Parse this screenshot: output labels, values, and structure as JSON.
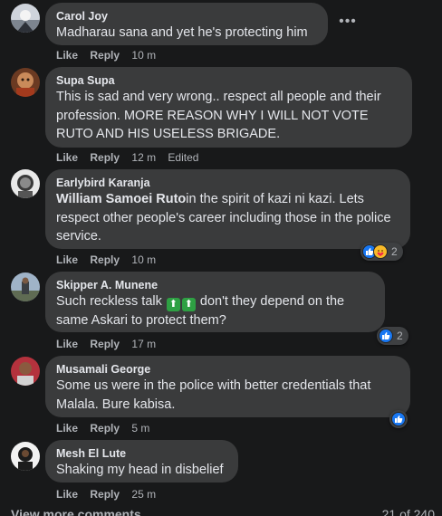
{
  "comments": [
    {
      "author": "Carol Joy",
      "text": "Madharau sana and yet he's protecting him",
      "like": "Like",
      "reply": "Reply",
      "time": "10 m"
    },
    {
      "author": "Supa Supa",
      "text": "This is sad and very wrong.. respect all people and their profession. MORE REASON WHY I WILL NOT VOTE RUTO AND HIS USELESS BRIGADE.",
      "like": "Like",
      "reply": "Reply",
      "time": "12 m",
      "edited": "Edited"
    },
    {
      "author": "Earlybird Karanja",
      "mention": "William Samoei Ruto",
      "text": "in the spirit of kazi ni kazi. Lets respect other people's career including those in the police service.",
      "like": "Like",
      "reply": "Reply",
      "time": "10 m",
      "reactions": "2"
    },
    {
      "author": "Skipper A. Munene",
      "text_before": "Such reckless talk",
      "text_after": "don't they depend on the same Askari to protect them?",
      "like": "Like",
      "reply": "Reply",
      "time": "17 m",
      "reactions": "2"
    },
    {
      "author": "Musamali George",
      "text": "Some us were in the police with better credentials that Malala. Bure kabisa.",
      "like": "Like",
      "reply": "Reply",
      "time": "5 m"
    },
    {
      "author": "Mesh El Lute",
      "text": "Shaking my head in disbelief",
      "like": "Like",
      "reply": "Reply",
      "time": "25 m"
    }
  ],
  "footer": {
    "view_more": "View more comments",
    "count": "21 of 240"
  },
  "colors": {
    "background": "#18191a",
    "bubble": "#3a3b3c",
    "like_blue": "#1877f2",
    "haha_yellow": "#f7b928"
  },
  "icons": {
    "more": "more-horizontal-icon",
    "like": "like-reaction-icon",
    "care": "care-reaction-icon"
  }
}
